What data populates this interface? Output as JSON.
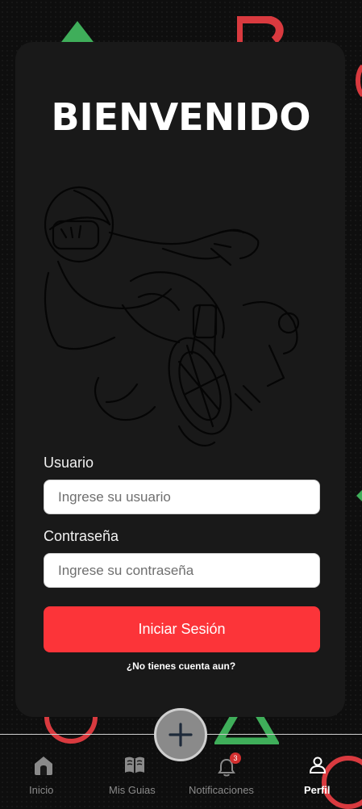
{
  "header": {
    "title": "BIENVENIDO"
  },
  "form": {
    "username_label": "Usuario",
    "username_placeholder": "Ingrese su usuario",
    "username_value": "",
    "password_label": "Contraseña",
    "password_placeholder": "Ingrese su contraseña",
    "password_value": "",
    "submit_label": "Iniciar Sesión",
    "register_link": "¿No tienes cuenta aun?"
  },
  "nav": {
    "items": [
      {
        "label": "Inicio",
        "icon": "home-icon",
        "active": false
      },
      {
        "label": "Mis Guias",
        "icon": "book-icon",
        "active": false
      },
      {
        "label": "Notificaciones",
        "icon": "bell-icon",
        "active": false,
        "badge": "3"
      },
      {
        "label": "Perfil",
        "icon": "user-icon",
        "active": true
      }
    ],
    "fab_icon": "plus-icon"
  },
  "colors": {
    "background": "#0e0e0e",
    "card": "#191919",
    "accent": "#fc3439",
    "input_bg": "#ffffff",
    "shape_green": "#3fae5a",
    "shape_red": "#d93a3f"
  }
}
